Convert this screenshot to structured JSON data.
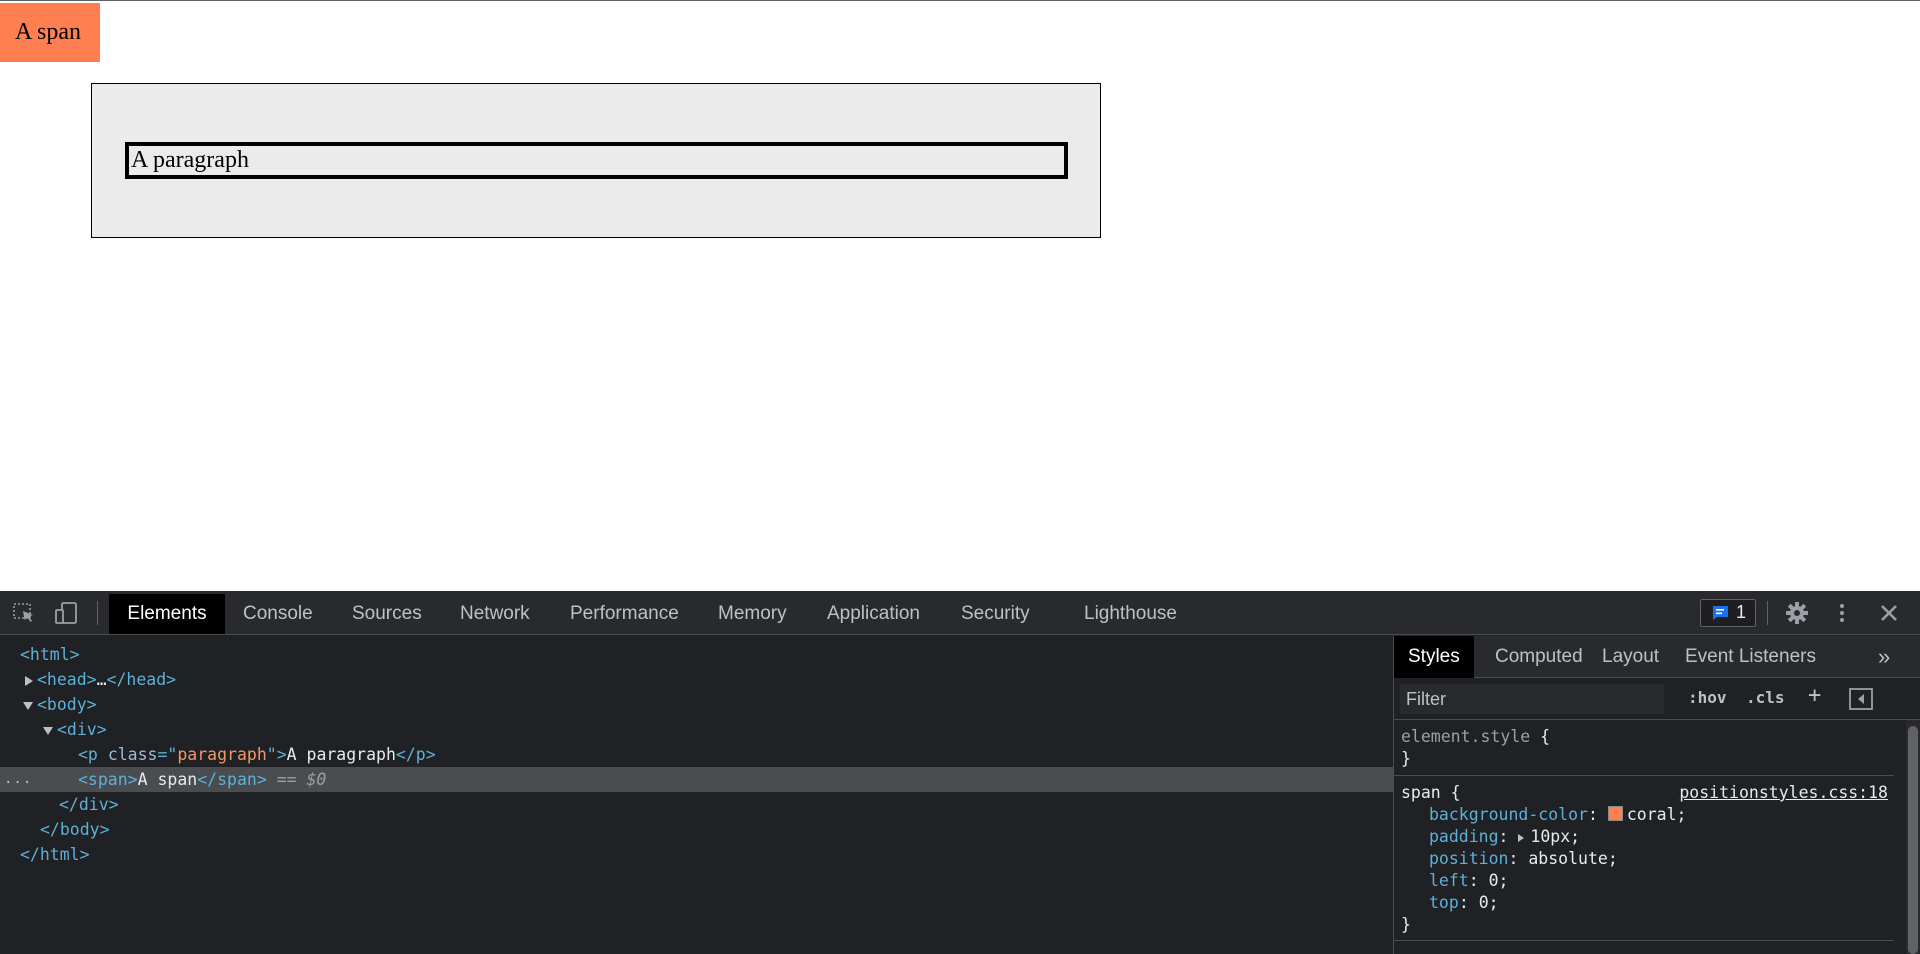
{
  "page": {
    "span_text": "A span",
    "paragraph_text": "A paragraph",
    "span_color": "#ff7f50"
  },
  "devtools": {
    "tabs": [
      "Elements",
      "Console",
      "Sources",
      "Network",
      "Performance",
      "Memory",
      "Application",
      "Security",
      "Lighthouse"
    ],
    "active_tab": "Elements",
    "issues_count": "1",
    "icons": {
      "inspect": "inspect-element-icon",
      "device": "device-toolbar-icon",
      "issues": "issues-chat-icon",
      "settings": "gear-icon",
      "more": "more-vert-icon",
      "close": "close-icon"
    },
    "dom": {
      "html_open": "<html>",
      "head": "<head>",
      "head_ellipsis": "…",
      "head_close": "</head>",
      "body_open": "<body>",
      "div_open": "<div>",
      "p_open_tag": "<p",
      "p_class_attr": "class",
      "p_class_eq": "=\"",
      "p_class_value": "paragraph",
      "p_class_end": "\">",
      "p_text": "A paragraph",
      "p_close": "</p>",
      "span_open": "<span>",
      "span_text": "A span",
      "span_close": "</span>",
      "selected_marker": " == $0",
      "div_close": "</div>",
      "body_close": "</body>",
      "html_close": "</html>",
      "ellipsis_dots": "..."
    },
    "styles_pane": {
      "subtabs": [
        "Styles",
        "Computed",
        "Layout",
        "Event Listeners"
      ],
      "active_subtab": "Styles",
      "overflow": "»",
      "filter_placeholder": "Filter",
      "hov": ":hov",
      "cls": ".cls",
      "plus": "+",
      "element_style_selector": "element.style",
      "open_brace": " {",
      "close_brace": "}",
      "span_selector": "span",
      "span_source": "positionstyles.css:18",
      "declarations": [
        {
          "prop": "background-color",
          "value": "coral;",
          "swatch": "#ff7f50"
        },
        {
          "prop": "padding",
          "value": "10px;",
          "expandable": true
        },
        {
          "prop": "position",
          "value": "absolute;"
        },
        {
          "prop": "left",
          "value": "0;"
        },
        {
          "prop": "top",
          "value": "0;"
        }
      ]
    }
  }
}
